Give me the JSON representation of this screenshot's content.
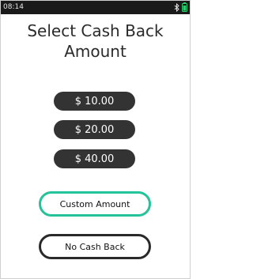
{
  "status_bar": {
    "time": "08:14",
    "icons": [
      "bluetooth-icon",
      "battery-icon"
    ],
    "battery_color": "#2ecc71"
  },
  "screen": {
    "title_line1": "Select Cash Back",
    "title_line2": "Amount"
  },
  "amounts": [
    {
      "label": "$ 10.00"
    },
    {
      "label": "$ 20.00"
    },
    {
      "label": "$ 40.00"
    }
  ],
  "actions": {
    "custom_label": "Custom Amount",
    "no_cash_back_label": "No Cash Back"
  },
  "colors": {
    "amount_button_bg": "#333333",
    "custom_border": "#24c39a",
    "no_cash_back_border": "#2a2a2a"
  }
}
